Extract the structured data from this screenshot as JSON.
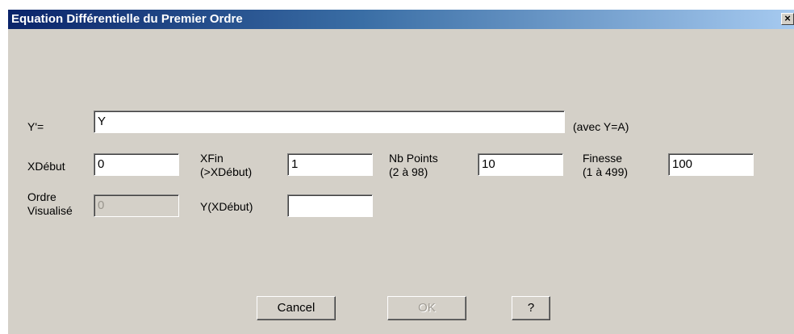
{
  "window": {
    "title": "Equation Différentielle du Premier Ordre",
    "close_label": "×"
  },
  "equation": {
    "label": "Y'=",
    "value": "Y",
    "hint": "(avec Y=A)"
  },
  "params": {
    "xdebut": {
      "label": "XDébut",
      "value": "0"
    },
    "xfin": {
      "label_line1": "XFin",
      "label_line2": "(>XDébut)",
      "value": "1"
    },
    "nbpoints": {
      "label_line1": "Nb Points",
      "label_line2": "(2 à 98)",
      "value": "10"
    },
    "finesse": {
      "label_line1": "Finesse",
      "label_line2": "(1 à 499)",
      "value": "100"
    },
    "ordre": {
      "label_line1": "Ordre",
      "label_line2": "Visualisé",
      "value": "0"
    },
    "yxdebut": {
      "label": "Y(XDébut)",
      "value": ""
    }
  },
  "buttons": {
    "cancel": "Cancel",
    "ok": "OK",
    "help": "?"
  }
}
